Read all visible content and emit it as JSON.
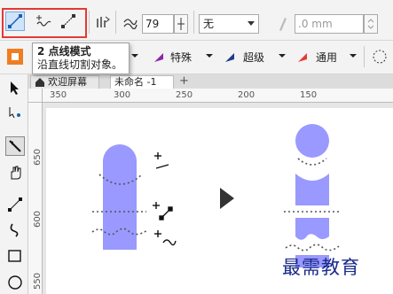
{
  "propbar": {
    "smoothing_value": "79",
    "outline_width": "无",
    "size_value": ".0 mm"
  },
  "tooltip": {
    "title": "2 点线模式",
    "desc": "沿直线切割对象。"
  },
  "presets": {
    "item1": "特殊",
    "item2": "超级",
    "item3": "通用"
  },
  "tabs": {
    "welcome": "欢迎屏幕",
    "doc": "未命名 -1",
    "add": "+"
  },
  "ruler": {
    "h": [
      "350",
      "300",
      "250",
      "200",
      "150"
    ],
    "v": [
      "650",
      "600",
      "550"
    ]
  },
  "watermark": "最需教育",
  "colors": {
    "shape": "#9999ff",
    "highlight": "#e53935",
    "tab_active": "#ffffff"
  },
  "icons": [
    "two-point-line-icon",
    "freehand-icon",
    "bezier-icon",
    "smoothing-icon",
    "pick-tool-icon",
    "pan-icon",
    "rectangle-icon"
  ]
}
